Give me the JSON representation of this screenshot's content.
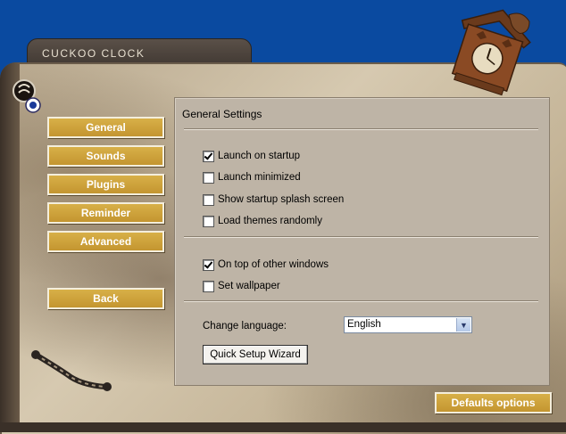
{
  "app": {
    "title": "CUCKOO CLOCK"
  },
  "colors": {
    "desktop": "#0a4aa0",
    "button_gold": "#c49530",
    "panel": "#beb4a6"
  },
  "sidebar": {
    "items": [
      {
        "label": "General"
      },
      {
        "label": "Sounds"
      },
      {
        "label": "Plugins"
      },
      {
        "label": "Reminder"
      },
      {
        "label": "Advanced"
      }
    ],
    "back_label": "Back"
  },
  "settings": {
    "title": "General Settings",
    "startup_options": [
      {
        "label": "Launch on startup",
        "checked": true
      },
      {
        "label": "Launch minimized",
        "checked": false
      },
      {
        "label": "Show startup splash screen",
        "checked": false
      },
      {
        "label": "Load themes randomly",
        "checked": false
      }
    ],
    "window_options": [
      {
        "label": "On top of other windows",
        "checked": true
      },
      {
        "label": "Set wallpaper",
        "checked": false
      }
    ],
    "language_label": "Change language:",
    "language_value": "English",
    "wizard_label": "Quick Setup Wizard"
  },
  "footer": {
    "defaults_label": "Defaults options"
  },
  "icons": {
    "logo": "cuckoo-logo-icon",
    "dropdown": "chevron-down-icon",
    "clock": "cuckoo-clock-decoration",
    "chain": "chain-decoration"
  }
}
